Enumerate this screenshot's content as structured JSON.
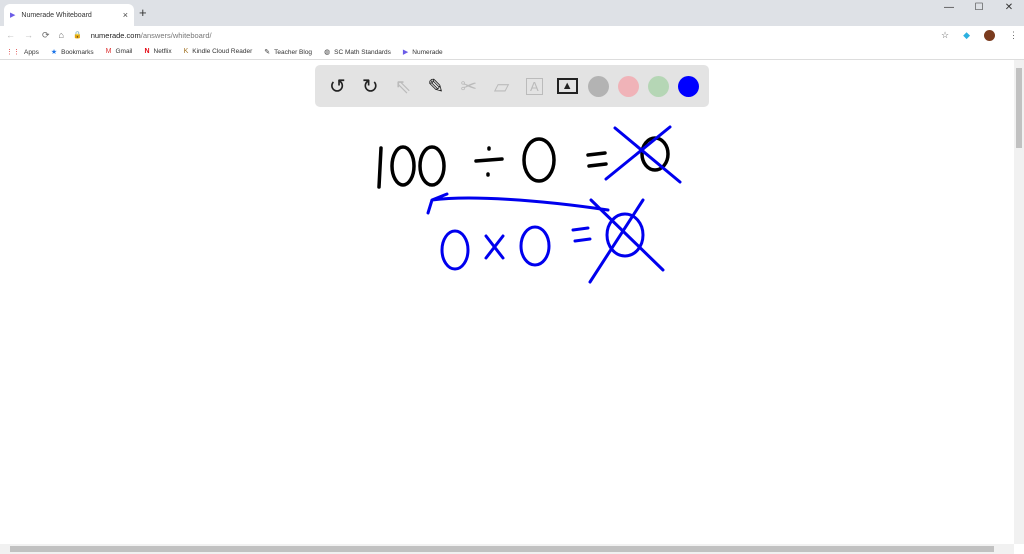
{
  "browser": {
    "tab_title": "Numerade Whiteboard",
    "tab_close": "×",
    "new_tab": "+",
    "window_controls": [
      "—",
      "☐",
      "✕"
    ],
    "url_host": "numerade.com",
    "url_path": "/answers/whiteboard/",
    "nav": {
      "back": "←",
      "forward": "→",
      "reload": "⟳",
      "home": "⌂"
    },
    "bookmarks": [
      {
        "icon": "⋮⋮",
        "label": "Apps"
      },
      {
        "icon": "★",
        "label": "Bookmarks"
      },
      {
        "icon": "M",
        "label": "Gmail"
      },
      {
        "icon": "N",
        "label": "Netflix"
      },
      {
        "icon": "K",
        "label": "Kindle Cloud Reader"
      },
      {
        "icon": "✎",
        "label": "Teacher Blog"
      },
      {
        "icon": "◍",
        "label": "SC Math Standards"
      },
      {
        "icon": "▶",
        "label": "Numerade"
      }
    ]
  },
  "toolbar": {
    "tools": [
      {
        "name": "undo",
        "glyph": "↺",
        "enabled": true
      },
      {
        "name": "redo",
        "glyph": "↻",
        "enabled": true
      },
      {
        "name": "select",
        "glyph": "⇖",
        "enabled": false
      },
      {
        "name": "pen",
        "glyph": "✎",
        "enabled": true
      },
      {
        "name": "tools",
        "glyph": "✂",
        "enabled": false
      },
      {
        "name": "eraser",
        "glyph": "▱",
        "enabled": false
      },
      {
        "name": "text",
        "glyph": "A",
        "enabled": false
      },
      {
        "name": "image",
        "glyph": "▲",
        "enabled": true
      }
    ],
    "colors": [
      "#b3b3b3",
      "#f0b3b8",
      "#b5d6b5",
      "#0000ff"
    ]
  },
  "whiteboard": {
    "ink_black": "#000000",
    "ink_blue": "#0000ee"
  }
}
